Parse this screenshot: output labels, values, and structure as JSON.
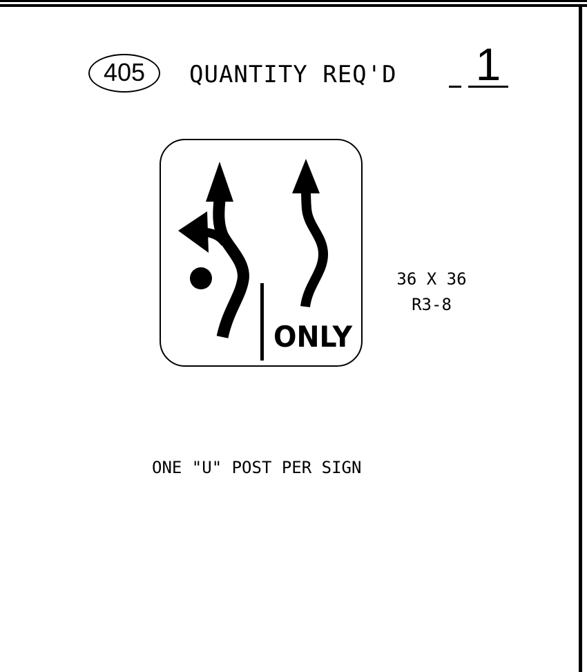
{
  "header": {
    "sign_number": "405",
    "quantity_label": "QUANTITY REQ'D",
    "quantity_value": "1"
  },
  "sign": {
    "legend": "ONLY",
    "size": "36 X 36",
    "code": "R3-8",
    "icons": [
      "left-turn-or-through-arrow-icon",
      "through-arrow-icon"
    ]
  },
  "notes": {
    "post": "ONE \"U\" POST PER SIGN"
  }
}
